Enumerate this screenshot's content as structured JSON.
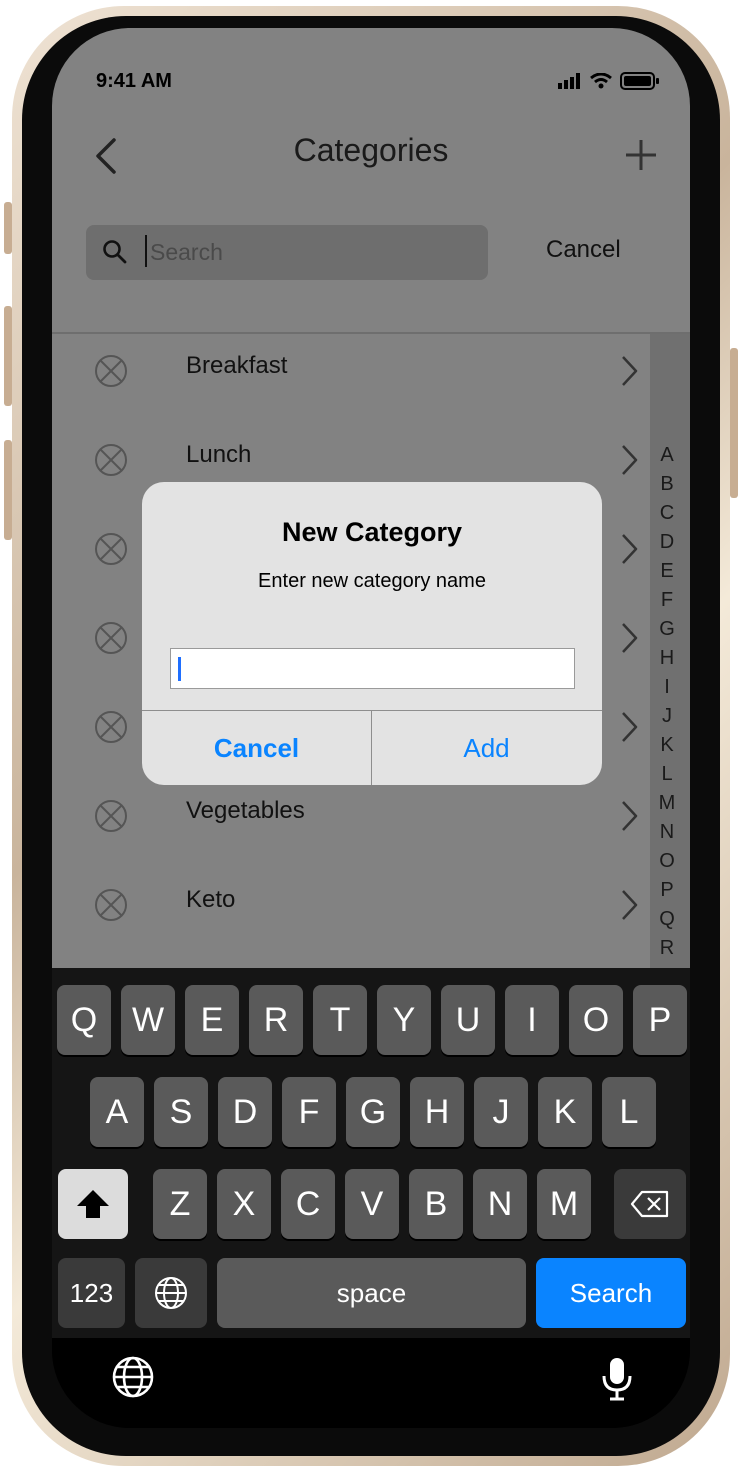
{
  "status_bar": {
    "time": "9:41 AM"
  },
  "nav": {
    "title": "Categories",
    "back_icon": "chevron-left-icon",
    "add_icon": "plus-icon"
  },
  "search": {
    "placeholder": "Search",
    "value": "",
    "cancel_label": "Cancel"
  },
  "categories": [
    {
      "label": "Breakfast"
    },
    {
      "label": "Lunch"
    },
    {
      "label": ""
    },
    {
      "label": ""
    },
    {
      "label": ""
    },
    {
      "label": "Vegetables"
    },
    {
      "label": "Keto"
    }
  ],
  "index_letters": [
    "A",
    "B",
    "C",
    "D",
    "E",
    "F",
    "G",
    "H",
    "I",
    "J",
    "K",
    "L",
    "M",
    "N",
    "O",
    "P",
    "Q",
    "R"
  ],
  "alert": {
    "title": "New Category",
    "message": "Enter new category name",
    "input_value": "",
    "cancel_label": "Cancel",
    "add_label": "Add"
  },
  "keyboard": {
    "row1": [
      "Q",
      "W",
      "E",
      "R",
      "T",
      "Y",
      "U",
      "I",
      "O",
      "P"
    ],
    "row2": [
      "A",
      "S",
      "D",
      "F",
      "G",
      "H",
      "J",
      "K",
      "L"
    ],
    "row3": [
      "Z",
      "X",
      "C",
      "V",
      "B",
      "N",
      "M"
    ],
    "numbers_label": "123",
    "space_label": "space",
    "return_label": "Search"
  },
  "colors": {
    "accent": "#0a84ff",
    "dim_overlay": "#828282",
    "keyboard_bg": "#151515"
  }
}
